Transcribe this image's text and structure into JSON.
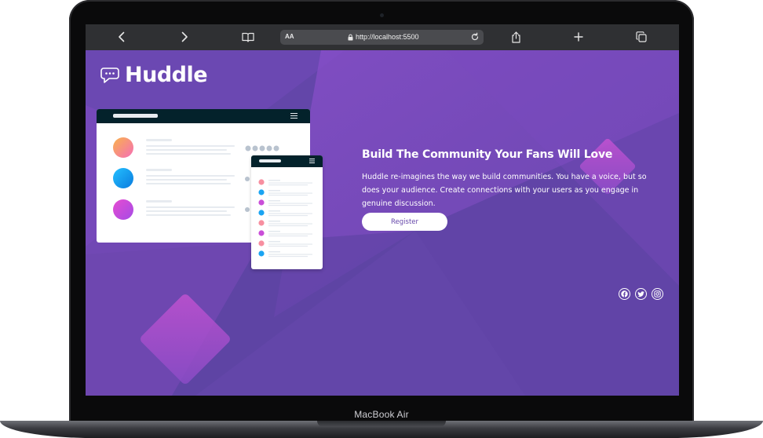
{
  "device": {
    "label": "MacBook Air"
  },
  "browser": {
    "text_size_label": "AA",
    "url": "http://localhost:5500",
    "icons": [
      "back-icon",
      "forward-icon",
      "bookmarks-icon",
      "lock-icon",
      "reload-icon",
      "share-icon",
      "new-tab-icon",
      "tabs-icon"
    ]
  },
  "page": {
    "logo_text": "Huddle",
    "hero": {
      "title": "Build The Community Your Fans Will Love",
      "body": "Huddle re-imagines the way we build communities. You have a voice, but so does your audience. Create connections with your users as you engage in genuine discussion.",
      "cta_label": "Register"
    },
    "socials": [
      "facebook-icon",
      "twitter-icon",
      "instagram-icon"
    ],
    "colors": {
      "background": "#6546aa",
      "accent": "#c553d6",
      "text": "#ffffff",
      "dark": "#03222b"
    }
  }
}
